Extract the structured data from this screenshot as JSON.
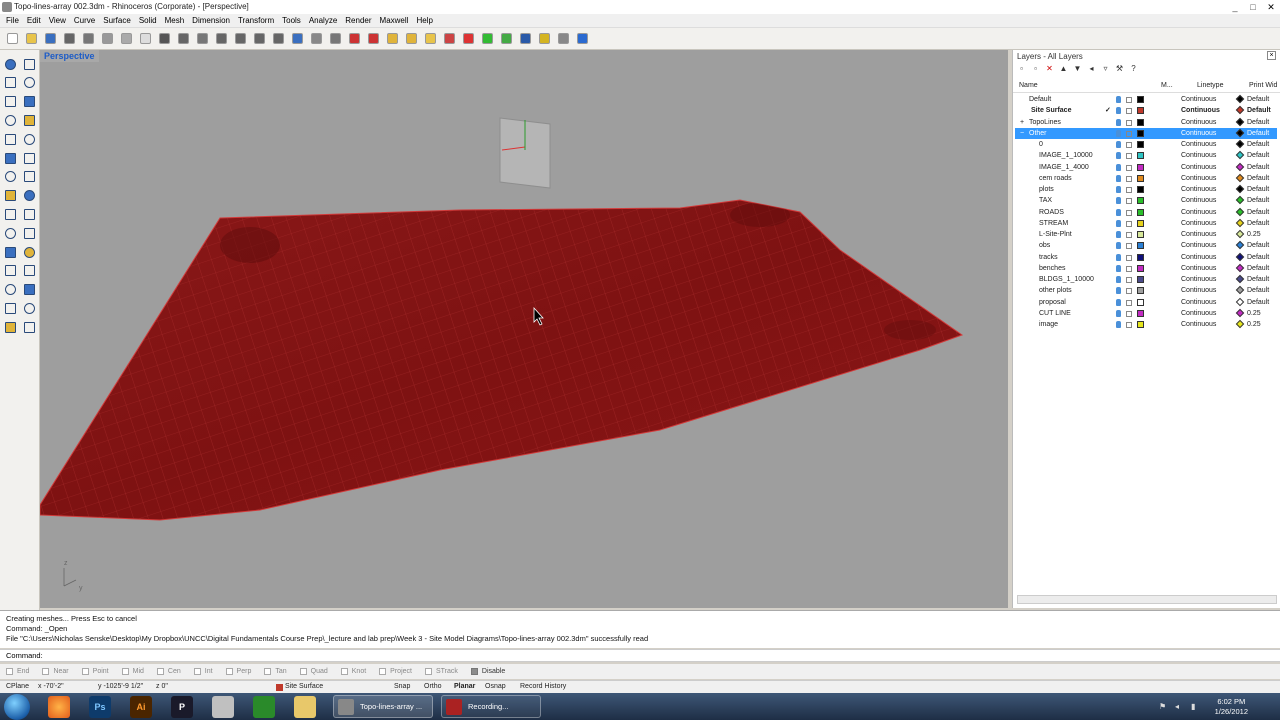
{
  "window": {
    "title": "Topo-lines-array 002.3dm - Rhinoceros (Corporate) - [Perspective]"
  },
  "menu": [
    "File",
    "Edit",
    "View",
    "Curve",
    "Surface",
    "Solid",
    "Mesh",
    "Dimension",
    "Transform",
    "Tools",
    "Analyze",
    "Render",
    "Maxwell",
    "Help"
  ],
  "viewport": {
    "label": "Perspective",
    "axis_z": "z",
    "axis_y": "y",
    "surface_color": "#8b1515"
  },
  "layers_panel": {
    "title": "Layers - All Layers",
    "headers": {
      "name": "Name",
      "material": "M...",
      "linetype": "Linetype",
      "print_width": "Print Wid"
    },
    "rows": [
      {
        "name": "Default",
        "color": "#000000",
        "linetype": "Continuous",
        "print": "Default",
        "dia": "#000000"
      },
      {
        "name": "Site Surface",
        "color": "#c0392b",
        "linetype": "Continuous",
        "print": "Default",
        "dia": "#c0392b",
        "bold": true,
        "current": "✓"
      },
      {
        "name": "TopoLines",
        "color": "#000000",
        "linetype": "Continuous",
        "print": "Default",
        "dia": "#000000",
        "expand": "+"
      },
      {
        "name": "Other",
        "color": "#000000",
        "linetype": "Continuous",
        "print": "Default",
        "dia": "#000000",
        "selected": true,
        "expand": "−"
      },
      {
        "name": "0",
        "color": "#000000",
        "linetype": "Continuous",
        "print": "Default",
        "dia": "#000000"
      },
      {
        "name": "IMAGE_1_10000",
        "color": "#2ec4c4",
        "linetype": "Continuous",
        "print": "Default",
        "dia": "#2ec4c4"
      },
      {
        "name": "IMAGE_1_4000",
        "color": "#c22bc2",
        "linetype": "Continuous",
        "print": "Default",
        "dia": "#c22bc2"
      },
      {
        "name": "cem roads",
        "color": "#e08a1e",
        "linetype": "Continuous",
        "print": "Default",
        "dia": "#e08a1e"
      },
      {
        "name": "plots",
        "color": "#000000",
        "linetype": "Continuous",
        "print": "Default",
        "dia": "#000000"
      },
      {
        "name": "TAX",
        "color": "#2bbf2b",
        "linetype": "Continuous",
        "print": "Default",
        "dia": "#2bbf2b"
      },
      {
        "name": "ROADS",
        "color": "#2bbf2b",
        "linetype": "Continuous",
        "print": "Default",
        "dia": "#2bbf2b"
      },
      {
        "name": "STREAM",
        "color": "#e6d21c",
        "linetype": "Continuous",
        "print": "Default",
        "dia": "#e6d21c"
      },
      {
        "name": "L-Site-Plnt",
        "color": "#d8e89a",
        "linetype": "Continuous",
        "print": "0.25",
        "dia": "#d8e89a"
      },
      {
        "name": "obs",
        "color": "#2a7fd4",
        "linetype": "Continuous",
        "print": "Default",
        "dia": "#2a7fd4"
      },
      {
        "name": "tracks",
        "color": "#10107a",
        "linetype": "Continuous",
        "print": "Default",
        "dia": "#10107a"
      },
      {
        "name": "benches",
        "color": "#c22bc2",
        "linetype": "Continuous",
        "print": "Default",
        "dia": "#c22bc2"
      },
      {
        "name": "BLDGS_1_10000",
        "color": "#4a4a8a",
        "linetype": "Continuous",
        "print": "Default",
        "dia": "#4a4a8a"
      },
      {
        "name": "other plots",
        "color": "#a0a0a0",
        "linetype": "Continuous",
        "print": "Default",
        "dia": "#a0a0a0"
      },
      {
        "name": "proposal",
        "color": "#ffffff",
        "linetype": "Continuous",
        "print": "Default",
        "dia": "#ffffff"
      },
      {
        "name": "CUT LINE",
        "color": "#c22bc2",
        "linetype": "Continuous",
        "print": "0.25",
        "dia": "#c22bc2"
      },
      {
        "name": "image",
        "color": "#e6e61c",
        "linetype": "Continuous",
        "print": "0.25",
        "dia": "#e6e61c"
      }
    ]
  },
  "command": {
    "history": [
      "Creating meshes... Press Esc to cancel",
      "Command: _Open",
      "File \"C:\\Users\\Nicholas Senske\\Desktop\\My Dropbox\\UNCC\\Digital Fundamentals Course Prep\\_lecture and lab prep\\Week 3 - Site Model Diagrams\\Topo-lines-array 002.3dm\" successfully read"
    ],
    "prompt": "Command:"
  },
  "osnap": [
    {
      "label": "End",
      "on": false
    },
    {
      "label": "Near",
      "on": false
    },
    {
      "label": "Point",
      "on": false
    },
    {
      "label": "Mid",
      "on": false
    },
    {
      "label": "Cen",
      "on": false
    },
    {
      "label": "Int",
      "on": false
    },
    {
      "label": "Perp",
      "on": false
    },
    {
      "label": "Tan",
      "on": false
    },
    {
      "label": "Quad",
      "on": false
    },
    {
      "label": "Knot",
      "on": false
    },
    {
      "label": "Project",
      "on": false
    },
    {
      "label": "STrack",
      "on": false
    },
    {
      "label": "Disable",
      "on": true
    }
  ],
  "status": {
    "cplane": "CPlane",
    "x": "x -70'-2\"",
    "y": "y -1025'-9 1/2\"",
    "z": "z 0\"",
    "layer": "Site Surface",
    "snap": "Snap",
    "ortho": "Ortho",
    "planar": "Planar",
    "osnap": "Osnap",
    "record_history": "Record History"
  },
  "taskbar": {
    "tasks": [
      {
        "label": "Topo-lines-array ...",
        "active": true
      },
      {
        "label": "Recording...",
        "active": false
      }
    ],
    "time": "6:02 PM",
    "date": "1/26/2012"
  }
}
